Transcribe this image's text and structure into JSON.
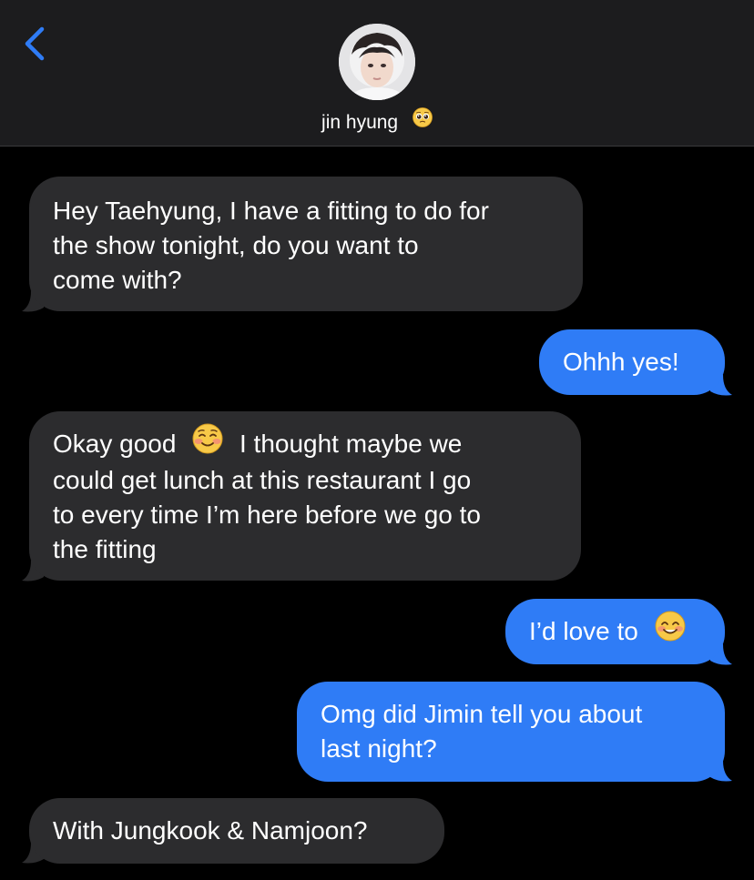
{
  "header": {
    "contact_name": "jin hyung",
    "name_emoji": "pleading-face-emoji",
    "back_icon": "chevron-left-icon",
    "colors": {
      "back_icon": "#2f7cf6",
      "header_bg": "#1c1c1e"
    }
  },
  "messages": [
    {
      "direction": "incoming",
      "lines": [
        "Hey Taehyung, I have a fitting to do for",
        "the show tonight, do you want to",
        "come with?"
      ]
    },
    {
      "direction": "outgoing",
      "lines": [
        "Ohhh yes!"
      ]
    },
    {
      "direction": "incoming",
      "lines": [
        "Okay good",
        "I thought maybe we",
        "could get lunch at this restaurant I go",
        "to every time I’m here before we go to",
        "the fitting"
      ],
      "emoji": "smiling-face-emoji"
    },
    {
      "direction": "outgoing",
      "lines": [
        "I’d love to"
      ],
      "emoji": "smiling-face-with-smiling-eyes-emoji"
    },
    {
      "direction": "outgoing",
      "lines": [
        "Omg did Jimin tell you about",
        "last night?"
      ]
    },
    {
      "direction": "incoming",
      "lines": [
        "With Jungkook & Namjoon?"
      ]
    }
  ],
  "colors": {
    "incoming_bubble": "#2c2c2e",
    "outgoing_bubble": "#2f7cf6",
    "background": "#000000"
  }
}
